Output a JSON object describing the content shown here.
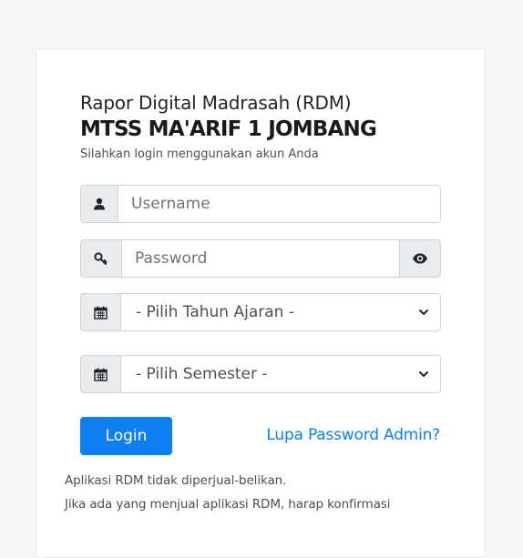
{
  "header": {
    "app_title": "Rapor Digital Madrasah (RDM)",
    "school_name": "MTSS MA'ARIF 1 JOMBANG",
    "subtitle": "Silahkan login menggunakan akun Anda"
  },
  "form": {
    "username": {
      "placeholder": "Username",
      "value": "",
      "icon": "user-icon"
    },
    "password": {
      "placeholder": "Password",
      "value": "",
      "icon": "key-icon",
      "toggle_icon": "eye-icon"
    },
    "tahun_ajaran": {
      "selected": "- Pilih Tahun Ajaran -",
      "icon": "calendar-icon"
    },
    "semester": {
      "selected": "- Pilih Semester -",
      "icon": "calendar-icon"
    },
    "login_label": "Login",
    "forgot_label": "Lupa Password Admin?"
  },
  "notes": {
    "line1": "Aplikasi RDM tidak diperjual-belikan.",
    "line2": "Jika ada yang menjual aplikasi RDM, harap konfirmasi"
  },
  "colors": {
    "primary": "#0d7ff0",
    "addon_bg": "#e9ecef",
    "border": "#ced4da",
    "page_bg": "#f6f6f6"
  }
}
